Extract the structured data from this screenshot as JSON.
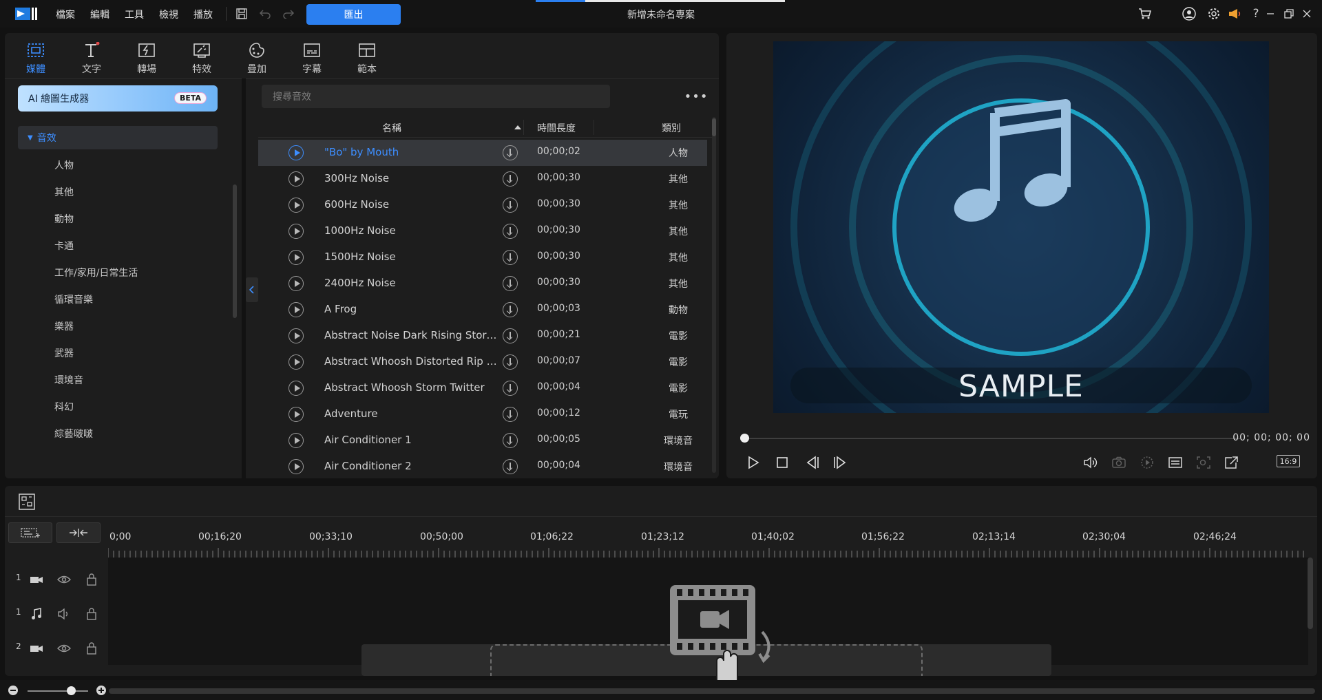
{
  "titlebar": {
    "menus": [
      "檔案",
      "編輯",
      "工具",
      "檢視",
      "播放"
    ],
    "export_label": "匯出",
    "project_title": "新增未命名專案"
  },
  "library": {
    "tabs": [
      {
        "label": "媒體",
        "icon": "media-icon",
        "active": true
      },
      {
        "label": "文字",
        "icon": "text-icon",
        "active": false
      },
      {
        "label": "轉場",
        "icon": "transition-icon",
        "active": false
      },
      {
        "label": "特效",
        "icon": "effects-icon",
        "active": false
      },
      {
        "label": "疊加",
        "icon": "overlay-icon",
        "active": false
      },
      {
        "label": "字幕",
        "icon": "subtitle-icon",
        "active": false
      },
      {
        "label": "範本",
        "icon": "template-icon",
        "active": false
      }
    ],
    "ai_button": {
      "label": "AI 繪圖生成器",
      "badge": "BETA"
    },
    "category_header": "音效",
    "categories": [
      "人物",
      "其他",
      "動物",
      "卡通",
      "工作/家用/日常生活",
      "循環音樂",
      "樂器",
      "武器",
      "環境音",
      "科幻",
      "綜藝啵啵"
    ],
    "search_placeholder": "搜尋音效",
    "columns": {
      "name": "名稱",
      "duration": "時間長度",
      "category": "類別"
    },
    "rows": [
      {
        "name": "\"Bo\" by Mouth",
        "duration": "00;00;02",
        "category": "人物",
        "selected": true
      },
      {
        "name": "300Hz Noise",
        "duration": "00;00;30",
        "category": "其他"
      },
      {
        "name": "600Hz Noise",
        "duration": "00;00;30",
        "category": "其他"
      },
      {
        "name": "1000Hz Noise",
        "duration": "00;00;30",
        "category": "其他"
      },
      {
        "name": "1500Hz Noise",
        "duration": "00;00;30",
        "category": "其他"
      },
      {
        "name": "2400Hz Noise",
        "duration": "00;00;30",
        "category": "其他"
      },
      {
        "name": "A Frog",
        "duration": "00;00;03",
        "category": "動物"
      },
      {
        "name": "Abstract Noise Dark Rising Storm S...",
        "duration": "00;00;21",
        "category": "電影"
      },
      {
        "name": "Abstract Whoosh Distorted Rip Bass",
        "duration": "00;00;07",
        "category": "電影"
      },
      {
        "name": "Abstract Whoosh Storm Twitter",
        "duration": "00;00;04",
        "category": "電影"
      },
      {
        "name": "Adventure",
        "duration": "00;00;12",
        "category": "電玩"
      },
      {
        "name": "Air Conditioner 1",
        "duration": "00;00;05",
        "category": "環境音"
      },
      {
        "name": "Air Conditioner 2",
        "duration": "00;00;04",
        "category": "環境音"
      }
    ]
  },
  "preview": {
    "sample_text": "SAMPLE",
    "timecode": "00; 00; 00; 00",
    "aspect_ratio": "16:9",
    "playhead_position": 0
  },
  "timeline": {
    "ruler_labels": [
      "0;00",
      "00;16;20",
      "00;33;10",
      "00;50;00",
      "01;06;22",
      "01;23;12",
      "01;40;02",
      "01;56;22",
      "02;13;14",
      "02;30;04",
      "02;46;24"
    ],
    "tracks": [
      {
        "number": "1",
        "type": "video"
      },
      {
        "number": "1",
        "type": "audio"
      },
      {
        "number": "2",
        "type": "video"
      }
    ]
  },
  "colors": {
    "accent": "#3d8eff",
    "export_button": "#2b7ff0",
    "panel": "#1d1d1d",
    "background": "#121212"
  }
}
